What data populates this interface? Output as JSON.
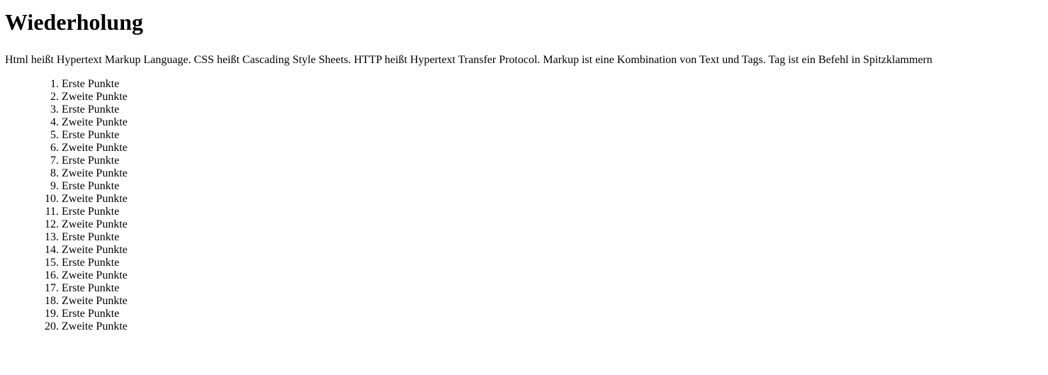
{
  "page": {
    "title": "Wiederholung",
    "intro": "Html heißt Hypertext Markup Language. CSS heißt Cascading Style Sheets. HTTP heißt Hypertext Transfer Protocol. Markup ist eine Kombination von Text und Tags. Tag ist ein Befehl in Spitzklammern",
    "list_items": [
      "Erste Punkte",
      "Zweite Punkte",
      "Erste Punkte",
      "Zweite Punkte",
      "Erste Punkte",
      "Zweite Punkte",
      "Erste Punkte",
      "Zweite Punkte",
      "Erste Punkte",
      "Zweite Punkte",
      "Erste Punkte",
      "Zweite Punkte",
      "Erste Punkte",
      "Zweite Punkte",
      "Erste Punkte",
      "Zweite Punkte",
      "Erste Punkte",
      "Zweite Punkte",
      "Erste Punkte",
      "Zweite Punkte"
    ]
  }
}
